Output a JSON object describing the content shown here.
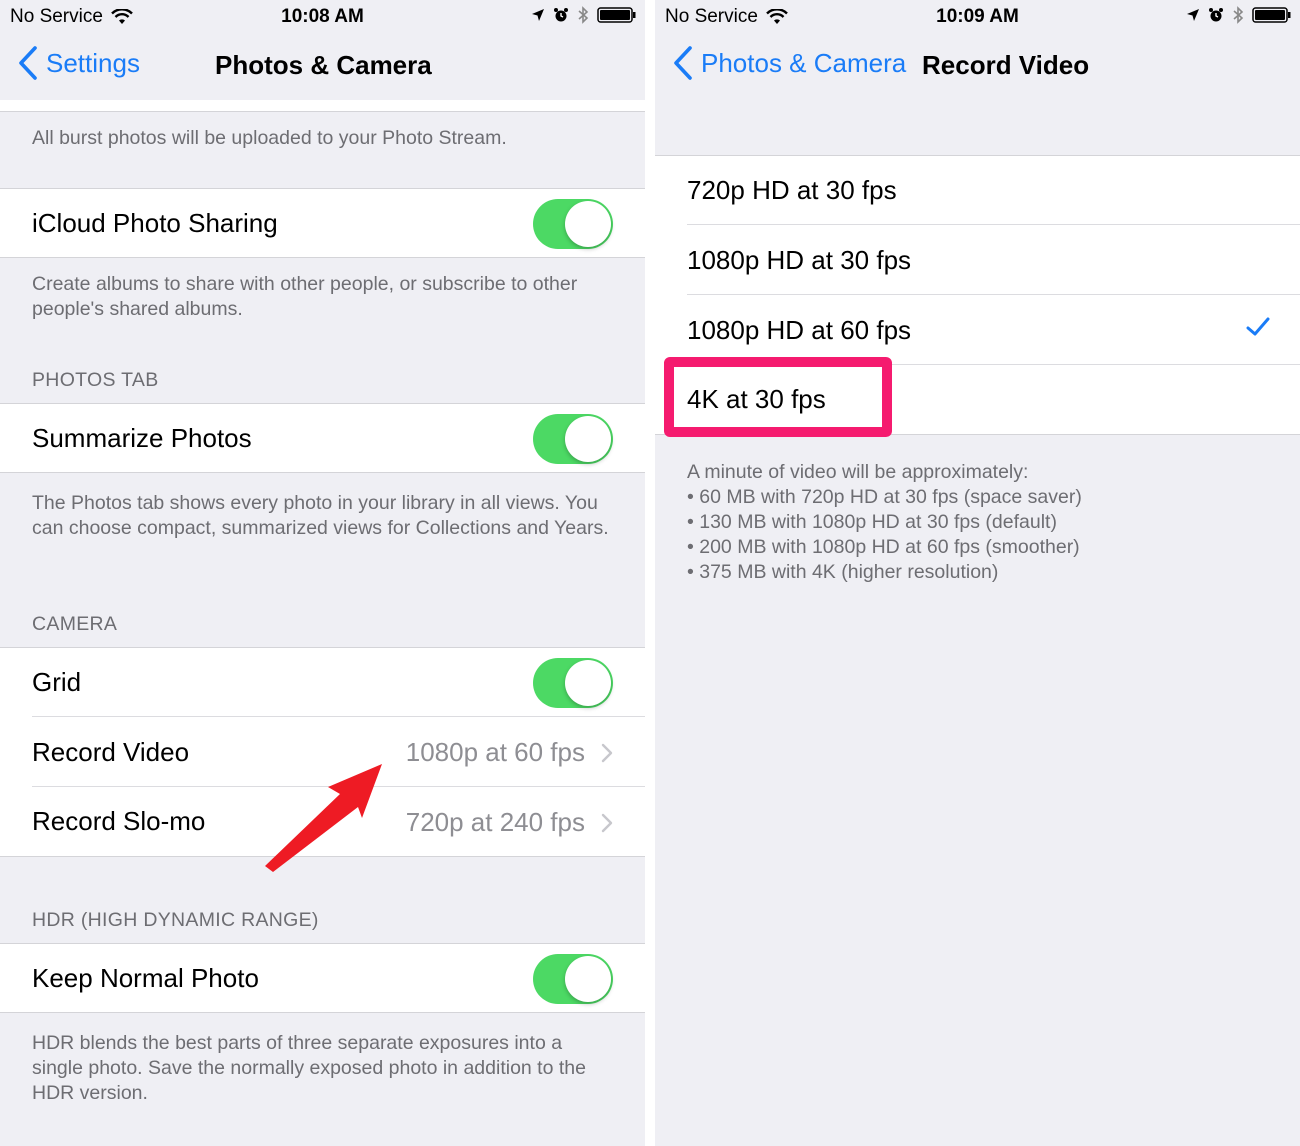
{
  "left": {
    "status": {
      "carrier": "No Service",
      "time": "10:08 AM"
    },
    "nav": {
      "back_label": "Settings",
      "title": "Photos & Camera"
    },
    "burst_footer": "All burst photos will be uploaded to your Photo Stream.",
    "icloud_sharing": {
      "label": "iCloud Photo Sharing",
      "footer": "Create albums to share with other people, or subscribe to other people's shared albums."
    },
    "photos_tab": {
      "header": "PHOTOS TAB",
      "summarize_label": "Summarize Photos",
      "footer": "The Photos tab shows every photo in your library in all views. You can choose compact, summarized views for Collections and Years."
    },
    "camera": {
      "header": "CAMERA",
      "grid_label": "Grid",
      "record_video_label": "Record Video",
      "record_video_value": "1080p at 60 fps",
      "record_slomo_label": "Record Slo-mo",
      "record_slomo_value": "720p at 240 fps"
    },
    "hdr": {
      "header": "HDR (HIGH DYNAMIC RANGE)",
      "keep_normal_label": "Keep Normal Photo",
      "footer": "HDR blends the best parts of three separate exposures into a single photo. Save the normally exposed photo in addition to the HDR version."
    }
  },
  "right": {
    "status": {
      "carrier": "No Service",
      "time": "10:09 AM"
    },
    "nav": {
      "back_label": "Photos & Camera",
      "title": "Record Video"
    },
    "options": [
      {
        "label": "720p HD at 30 fps"
      },
      {
        "label": "1080p HD at 30 fps"
      },
      {
        "label": "1080p HD at 60 fps"
      },
      {
        "label": "4K at 30 fps"
      }
    ],
    "footer_lines": [
      "A minute of video will be approximately:",
      "• 60 MB with 720p HD at 30 fps (space saver)",
      "• 130 MB with 1080p HD at 30 fps (default)",
      "• 200 MB with 1080p HD at 60 fps (smoother)",
      "• 375 MB with 4K (higher resolution)"
    ]
  },
  "colors": {
    "ios_blue": "#1a7cf7",
    "toggle_green": "#4cd964",
    "highlight_pink": "#f51b6f",
    "arrow_red": "#ee1b24"
  },
  "icons": {
    "status": [
      "wifi-icon",
      "location-arrow-icon",
      "alarm-icon",
      "bluetooth-icon",
      "battery-icon"
    ],
    "nav": [
      "chevron-left-icon"
    ],
    "cell": [
      "chevron-right-icon",
      "checkmark-icon"
    ]
  }
}
